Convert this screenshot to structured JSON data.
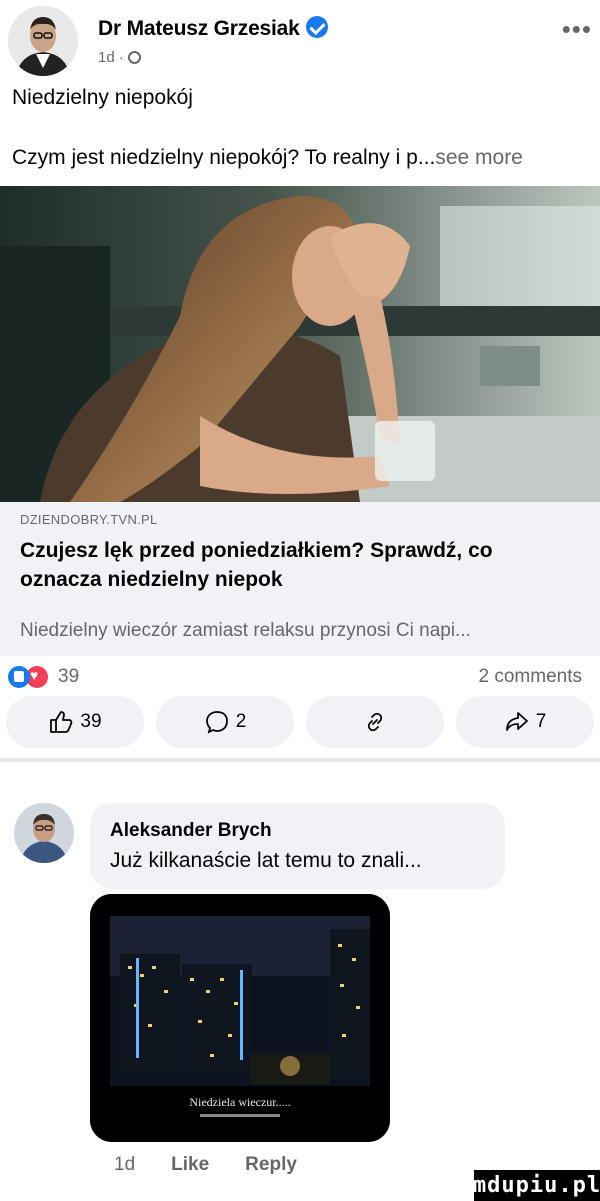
{
  "post": {
    "author": "Dr Mateusz Grzesiak",
    "time": "1d",
    "title": "Niedzielny niepokój",
    "body": "Czym jest niedzielny niepokój? To realny i p...",
    "see_more": "see more"
  },
  "link": {
    "domain": "DZIENDOBRY.TVN.PL",
    "headline": "Czujesz lęk przed poniedziałkiem? Sprawdź, co oznacza niedzielny niepok",
    "description": "Niedzielny wieczór zamiast relaksu przynosi Ci napi..."
  },
  "stats": {
    "reactions": "39",
    "comments": "2 comments"
  },
  "actions": {
    "like_count": "39",
    "comment_count": "2",
    "share_count": "7"
  },
  "comment": {
    "author": "Aleksander Brych",
    "text": "Już kilkanaście lat temu to znali...",
    "image_caption": "Niedziela wieczur.....",
    "time": "1d",
    "like": "Like",
    "reply": "Reply"
  },
  "watermark": "mdupiu.pl",
  "colors": {
    "accent": "#1877f2",
    "love": "#f33e58",
    "secondary_text": "#65676b",
    "surface": "#f0f2f5"
  },
  "icons": [
    "verified-badge-icon",
    "globe-icon",
    "more-icon",
    "like-reaction-icon",
    "love-reaction-icon",
    "thumbs-up-icon",
    "comment-icon",
    "link-icon",
    "share-icon"
  ]
}
